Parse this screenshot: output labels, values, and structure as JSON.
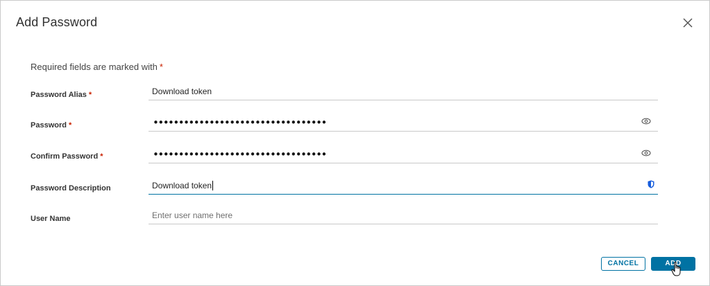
{
  "dialog": {
    "title": "Add Password",
    "required_note": "Required fields are marked with",
    "required_marker": "*"
  },
  "fields": {
    "alias": {
      "label": "Password Alias",
      "value": "Download token",
      "required": true
    },
    "password": {
      "label": "Password",
      "masked_value": "••••••••••••••••••••••••••••••••••",
      "required": true
    },
    "confirm": {
      "label": "Confirm Password",
      "masked_value": "••••••••••••••••••••••••••••••••••",
      "required": true
    },
    "description": {
      "label": "Password Description",
      "value": "Download token",
      "required": false
    },
    "username": {
      "label": "User Name",
      "value": "",
      "placeholder": "Enter user name here",
      "required": false
    }
  },
  "buttons": {
    "cancel_label": "CANCEL",
    "add_label": "ADD"
  },
  "colors": {
    "accent": "#0072a3",
    "required": "#c92100",
    "text": "#313131"
  },
  "icons": {
    "close": "close-icon",
    "reveal": "eye-icon",
    "password_manager": "shield-icon",
    "pointer": "hand-cursor-icon"
  }
}
